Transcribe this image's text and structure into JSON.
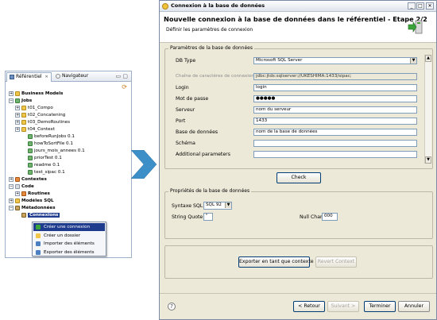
{
  "repository": {
    "tabs": [
      {
        "label": "Référentiel",
        "close": "✕"
      },
      {
        "label": "Navigateur"
      }
    ],
    "minimize_glyph": "▭",
    "maximize_glyph": "▢",
    "toolbar_glyph": "⟳",
    "tree": [
      {
        "label": "Business Models",
        "icon": "business-models-icon",
        "bold": true,
        "expander": "+"
      },
      {
        "label": "Jobs",
        "icon": "jobs-icon",
        "bold": true,
        "expander": "−"
      },
      {
        "label": "t01_Compo",
        "icon": "folder-icon",
        "expander": "+"
      },
      {
        "label": "t02_Concatening",
        "icon": "folder-icon",
        "expander": "+"
      },
      {
        "label": "t03_DemoRoutines",
        "icon": "folder-icon",
        "expander": "+"
      },
      {
        "label": "t04_Context",
        "icon": "folder-icon",
        "expander": "+"
      },
      {
        "label": "beforeRunJobs 0.1",
        "icon": "job-icon"
      },
      {
        "label": "howToSortFile 0.1",
        "icon": "job-icon"
      },
      {
        "label": "jours_mois_annees 0.1",
        "icon": "job-icon"
      },
      {
        "label": "priorTest 0.1",
        "icon": "job-icon"
      },
      {
        "label": "readme 0.1",
        "icon": "job-icon"
      },
      {
        "label": "test_sipac 0.1",
        "icon": "job-icon"
      },
      {
        "label": "Contextes",
        "icon": "contexts-icon",
        "bold": true,
        "expander": "+"
      },
      {
        "label": "Code",
        "icon": "code-icon",
        "bold": true,
        "expander": "−"
      },
      {
        "label": "Routines",
        "icon": "routines-icon",
        "bold": true,
        "expander": "+"
      },
      {
        "label": "Modèles SQL",
        "icon": "sql-models-icon",
        "bold": true,
        "expander": "+"
      },
      {
        "label": "Métadonnées",
        "icon": "metadata-icon",
        "bold": true,
        "expander": "−"
      },
      {
        "label": "Connexions",
        "icon": "connections-icon",
        "bold": true,
        "selected": true
      }
    ],
    "context_menu": [
      {
        "label": "Créer une connexion",
        "icon": "create-connection-icon",
        "highlighted": true
      },
      {
        "label": "Créer un dossier",
        "icon": "create-folder-icon"
      },
      {
        "label": "Importer des éléments",
        "icon": "import-icon"
      },
      {
        "label": "Exporter des éléments",
        "icon": "export-icon"
      }
    ]
  },
  "dialog": {
    "window_title": "Connexion à la base de données",
    "window_buttons": {
      "minimize": "_",
      "maximize": "□",
      "close": "✕"
    },
    "header_title": "Nouvelle connexion à la base de données dans le référentiel - Etape 2/2",
    "header_description": "Définir les paramètres de connexion",
    "db_group_title": "Paramètres de la base de données",
    "fields": {
      "db_type": {
        "label": "DB Type",
        "value": "Microsoft SQL Server"
      },
      "connection_string": {
        "label": "Chaîne de caractères de connexion",
        "value": "jdbc:jtds:sqlserver://UKESHIMA:1433/sipac;"
      },
      "login": {
        "label": "Login",
        "value": "login"
      },
      "password": {
        "label": "Mot de passe",
        "value": "●●●●●"
      },
      "server": {
        "label": "Serveur",
        "value": "nom du serveur"
      },
      "port": {
        "label": "Port",
        "value": "1433"
      },
      "database": {
        "label": "Base de données",
        "value": "nom de la base de données"
      },
      "schema": {
        "label": "Schéma",
        "value": ""
      },
      "additional": {
        "label": "Additional parameters",
        "value": ""
      }
    },
    "check_button": "Check",
    "properties_group_title": "Propriétés de la base de données",
    "syntax_sql": {
      "label": "Syntaxe SQL",
      "value": "SQL 92"
    },
    "string_quote": {
      "label": "String Quote",
      "value": "\""
    },
    "null_char": {
      "label": "Null Char",
      "value": "000"
    },
    "export_context_button": "Exporter en tant que contexte",
    "revert_context_button": "Revert Context",
    "footer": {
      "help": "?",
      "back": "< Retour",
      "next": "Suivant >",
      "finish": "Terminer",
      "cancel": "Annuler"
    }
  },
  "colors": {
    "selection": "#1f3b8e",
    "arrow": "#3d8fc8",
    "dialog_bg": "#ece9d8"
  }
}
